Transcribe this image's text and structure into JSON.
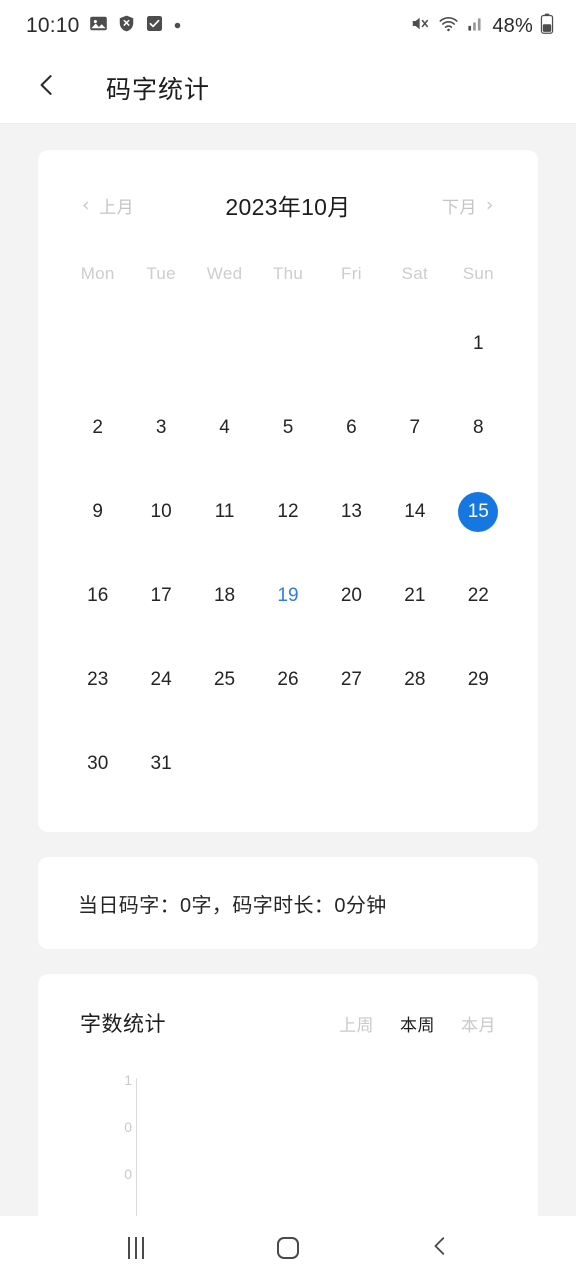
{
  "status_bar": {
    "time": "10:10",
    "battery_percent": "48%",
    "left_icons": [
      "image-icon",
      "shield-off-icon",
      "checkbox-icon",
      "dot-icon"
    ],
    "right_icons": [
      "mute-icon",
      "wifi-icon",
      "signal-icon",
      "battery-icon"
    ]
  },
  "header": {
    "back_icon": "chevron-left-icon",
    "title": "码字统计"
  },
  "calendar": {
    "prev_label": "上月",
    "next_label": "下月",
    "prev_icon": "chevron-left-icon",
    "next_icon": "chevron-right-icon",
    "current_month": "2023年10月",
    "weekdays": [
      "Mon",
      "Tue",
      "Wed",
      "Thu",
      "Fri",
      "Sat",
      "Sun"
    ],
    "leading_blanks": 6,
    "days": [
      {
        "n": "1"
      },
      {
        "n": "2"
      },
      {
        "n": "3"
      },
      {
        "n": "4"
      },
      {
        "n": "5"
      },
      {
        "n": "6"
      },
      {
        "n": "7"
      },
      {
        "n": "8"
      },
      {
        "n": "9"
      },
      {
        "n": "10"
      },
      {
        "n": "11"
      },
      {
        "n": "12"
      },
      {
        "n": "13"
      },
      {
        "n": "14"
      },
      {
        "n": "15",
        "state": "selected"
      },
      {
        "n": "16"
      },
      {
        "n": "17"
      },
      {
        "n": "18"
      },
      {
        "n": "19",
        "state": "marked"
      },
      {
        "n": "20"
      },
      {
        "n": "21"
      },
      {
        "n": "22"
      },
      {
        "n": "23"
      },
      {
        "n": "24"
      },
      {
        "n": "25"
      },
      {
        "n": "26"
      },
      {
        "n": "27"
      },
      {
        "n": "28"
      },
      {
        "n": "29"
      },
      {
        "n": "30"
      },
      {
        "n": "31"
      }
    ],
    "selected_color": "#1677e0",
    "marked_color": "#2f80d8"
  },
  "summary": {
    "text": "当日码字：0字，码字时长：0分钟"
  },
  "chart_card": {
    "title": "字数统计",
    "tabs": [
      {
        "label": "上周",
        "active": false
      },
      {
        "label": "本周",
        "active": true
      },
      {
        "label": "本月",
        "active": false
      }
    ]
  },
  "chart_data": {
    "type": "bar",
    "title": "字数统计",
    "xlabel": "",
    "ylabel": "",
    "categories": [],
    "values": [],
    "yticks": [
      "1",
      "0",
      "0"
    ],
    "ylim": [
      0,
      1
    ],
    "grid": false,
    "legend": "none",
    "note": "本周 (this week) selected; all values are zero so no bars are drawn"
  },
  "nav_bar": {
    "recents_icon": "recents-icon",
    "home_icon": "home-icon",
    "back_icon": "chevron-left-icon"
  }
}
